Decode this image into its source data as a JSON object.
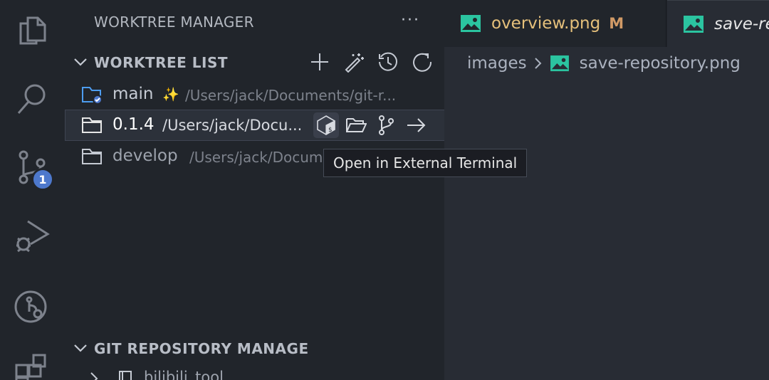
{
  "activity_bar": {
    "scm_badge": "1",
    "icons": [
      "files-icon",
      "search-icon",
      "source-control-icon",
      "run-debug-icon",
      "git-graph-icon",
      "extensions-icon"
    ]
  },
  "sidebar": {
    "title": "WORKTREE MANAGER",
    "more_label": "···",
    "worktree_section": {
      "label": "WORKTREE LIST",
      "actions": [
        "add-icon",
        "magic-wand-icon",
        "history-icon",
        "refresh-icon"
      ],
      "items": [
        {
          "name": "main",
          "marker": "✨",
          "path": "/Users/jack/Documents/git-r...",
          "current": true
        },
        {
          "name": "0.1.4",
          "path": "/Users/jack/Docu...",
          "selected": true
        },
        {
          "name": "develop",
          "path": "/Users/jack/Documents/git-r..."
        }
      ],
      "row_actions": [
        "terminal-icon",
        "folder-open-icon",
        "branch-icon",
        "arrow-right-icon"
      ]
    },
    "repo_section": {
      "label": "GIT REPOSITORY MANAGE",
      "first_item": "bilibili_tool"
    }
  },
  "tooltip": {
    "text": "Open in External Terminal"
  },
  "tabs": [
    {
      "label": "overview.png",
      "modified": "M",
      "color": "#e5c07b"
    },
    {
      "label": "save-repository.png",
      "italic": true,
      "color": "#e6e6e6"
    }
  ],
  "breadcrumb": {
    "folder": "images",
    "file": "save-repository.png"
  },
  "colors": {
    "accent": "#4d78cc",
    "image_icon": "#2bc4a0",
    "modified": "#d19a66",
    "sidebar_bg": "#21252b",
    "editor_bg": "#282c34"
  }
}
